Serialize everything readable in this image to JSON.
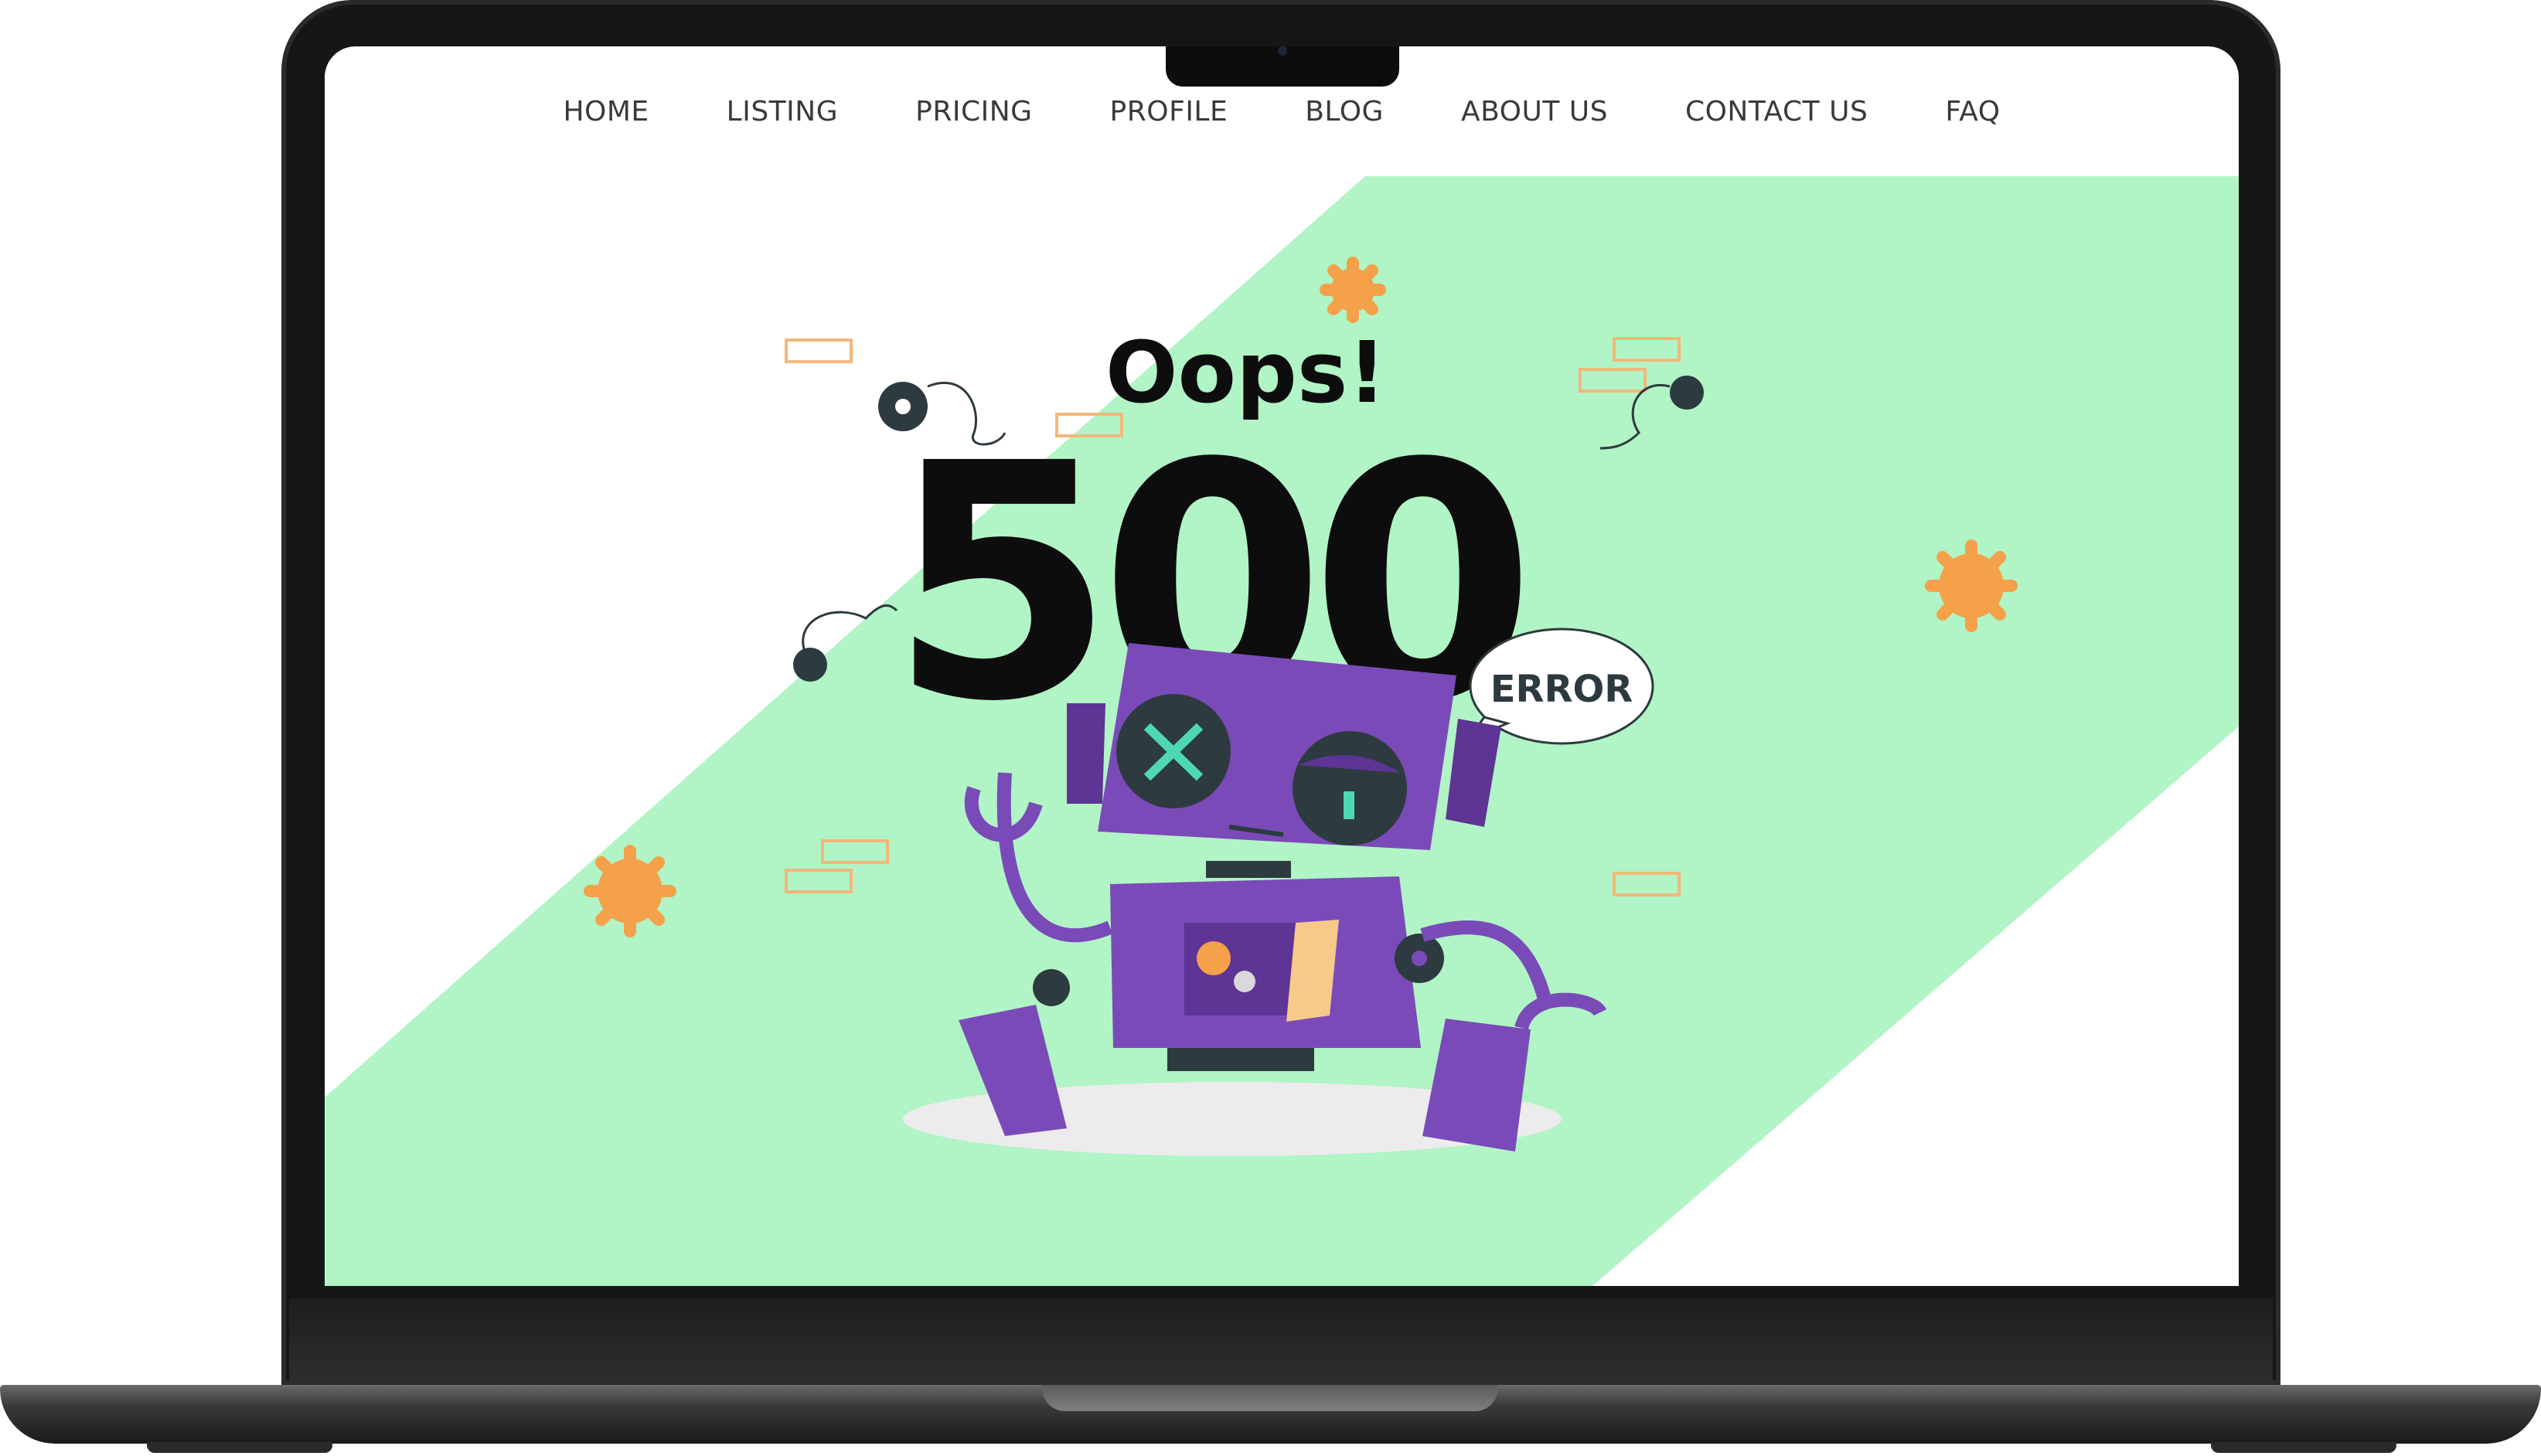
{
  "nav": {
    "items": [
      {
        "label": "HOME"
      },
      {
        "label": "LISTING"
      },
      {
        "label": "PRICING"
      },
      {
        "label": "PROFILE"
      },
      {
        "label": "BLOG"
      },
      {
        "label": "ABOUT US"
      },
      {
        "label": "CONTACT US"
      },
      {
        "label": "FAQ"
      }
    ]
  },
  "hero": {
    "oops": "Oops!",
    "code": "500",
    "bubble": "ERROR"
  },
  "colors": {
    "green": "#b1f4c6",
    "purple": "#7a4bb8",
    "purple_dark": "#5e3494",
    "orange": "#f4a14a",
    "teal": "#4fd7b4"
  }
}
